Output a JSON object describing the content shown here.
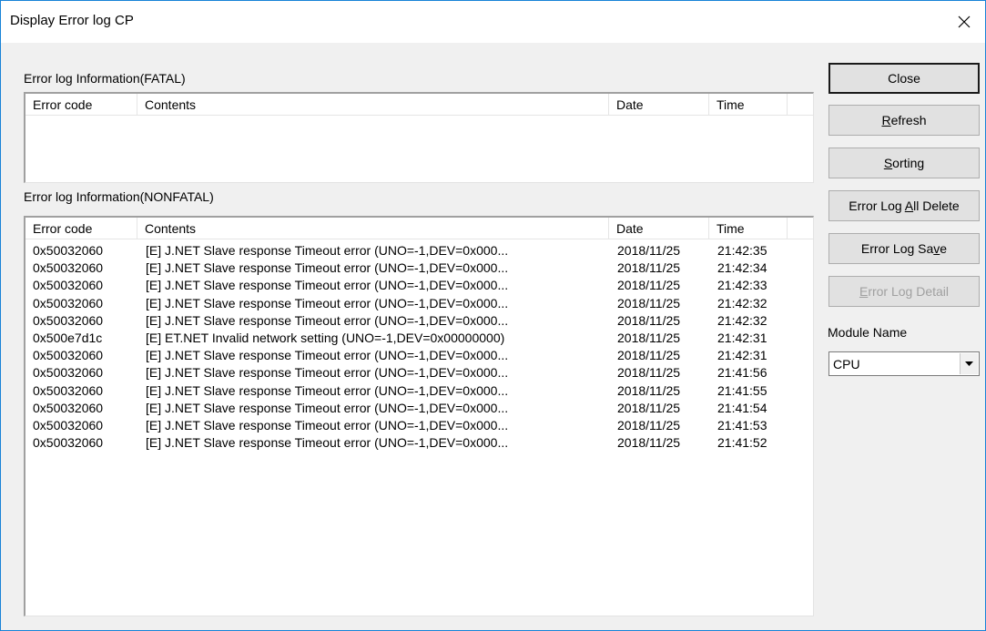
{
  "window": {
    "title": "Display Error log CP"
  },
  "fatal": {
    "label": "Error log Information(FATAL)",
    "columns": [
      "Error code",
      "Contents",
      "Date",
      "Time"
    ],
    "rows": []
  },
  "nonfatal": {
    "label": "Error log Information(NONFATAL)",
    "columns": [
      "Error code",
      "Contents",
      "Date",
      "Time"
    ],
    "rows": [
      {
        "code": "0x50032060",
        "contents": "[E] J.NET Slave response Timeout error (UNO=-1,DEV=0x000...",
        "date": "2018/11/25",
        "time": "21:42:35"
      },
      {
        "code": "0x50032060",
        "contents": "[E] J.NET Slave response Timeout error (UNO=-1,DEV=0x000...",
        "date": "2018/11/25",
        "time": "21:42:34"
      },
      {
        "code": "0x50032060",
        "contents": "[E] J.NET Slave response Timeout error (UNO=-1,DEV=0x000...",
        "date": "2018/11/25",
        "time": "21:42:33"
      },
      {
        "code": "0x50032060",
        "contents": "[E] J.NET Slave response Timeout error (UNO=-1,DEV=0x000...",
        "date": "2018/11/25",
        "time": "21:42:32"
      },
      {
        "code": "0x50032060",
        "contents": "[E] J.NET Slave response Timeout error (UNO=-1,DEV=0x000...",
        "date": "2018/11/25",
        "time": "21:42:32"
      },
      {
        "code": "0x500e7d1c",
        "contents": "[E] ET.NET Invalid network setting (UNO=-1,DEV=0x00000000)",
        "date": "2018/11/25",
        "time": "21:42:31"
      },
      {
        "code": "0x50032060",
        "contents": "[E] J.NET Slave response Timeout error (UNO=-1,DEV=0x000...",
        "date": "2018/11/25",
        "time": "21:42:31"
      },
      {
        "code": "0x50032060",
        "contents": "[E] J.NET Slave response Timeout error (UNO=-1,DEV=0x000...",
        "date": "2018/11/25",
        "time": "21:41:56"
      },
      {
        "code": "0x50032060",
        "contents": "[E] J.NET Slave response Timeout error (UNO=-1,DEV=0x000...",
        "date": "2018/11/25",
        "time": "21:41:55"
      },
      {
        "code": "0x50032060",
        "contents": "[E] J.NET Slave response Timeout error (UNO=-1,DEV=0x000...",
        "date": "2018/11/25",
        "time": "21:41:54"
      },
      {
        "code": "0x50032060",
        "contents": "[E] J.NET Slave response Timeout error (UNO=-1,DEV=0x000...",
        "date": "2018/11/25",
        "time": "21:41:53"
      },
      {
        "code": "0x50032060",
        "contents": "[E] J.NET Slave response Timeout error (UNO=-1,DEV=0x000...",
        "date": "2018/11/25",
        "time": "21:41:52"
      }
    ]
  },
  "buttons": {
    "close": {
      "label": "Close"
    },
    "refresh": {
      "pre": "",
      "key": "R",
      "post": "efresh"
    },
    "sorting": {
      "pre": "",
      "key": "S",
      "post": "orting"
    },
    "delete_all": {
      "pre": "Error Log ",
      "key": "A",
      "post": "ll Delete"
    },
    "save": {
      "pre": "Error Log Sa",
      "key": "v",
      "post": "e"
    },
    "detail": {
      "pre": "",
      "key": "E",
      "post": "rror Log Detail"
    }
  },
  "module": {
    "label": "Module Name",
    "value": "CPU"
  },
  "icons": {
    "close": "close-icon",
    "dropdown": "chevron-down-icon"
  }
}
